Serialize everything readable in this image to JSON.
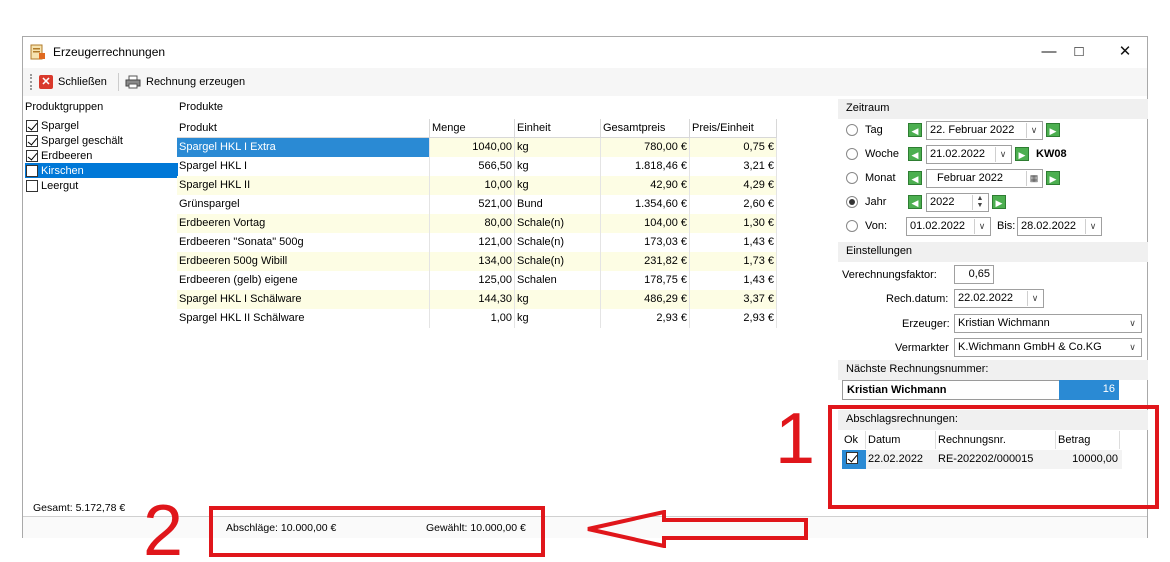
{
  "window": {
    "title": "Erzeugerrechnungen"
  },
  "toolbar": {
    "close_label": "Schließen",
    "invoice_label": "Rechnung erzeugen"
  },
  "groups": {
    "label": "Produktgruppen",
    "items": [
      {
        "label": "Spargel",
        "checked": true
      },
      {
        "label": "Spargel geschält",
        "checked": true
      },
      {
        "label": "Erdbeeren",
        "checked": true
      },
      {
        "label": "Kirschen",
        "checked": false
      },
      {
        "label": "Leergut",
        "checked": false
      }
    ]
  },
  "products": {
    "label": "Produkte",
    "columns": [
      "Produkt",
      "Menge",
      "Einheit",
      "Gesamtpreis",
      "Preis/Einheit"
    ],
    "rows": [
      [
        "Spargel HKL I Extra",
        "1040,00",
        "kg",
        "780,00 €",
        "0,75 €"
      ],
      [
        "Spargel HKL I",
        "566,50",
        "kg",
        "1.818,46 €",
        "3,21 €"
      ],
      [
        "Spargel HKL II",
        "10,00",
        "kg",
        "42,90 €",
        "4,29 €"
      ],
      [
        "Grünspargel",
        "521,00",
        "Bund",
        "1.354,60 €",
        "2,60 €"
      ],
      [
        "Erdbeeren Vortag",
        "80,00",
        "Schale(n)",
        "104,00 €",
        "1,30 €"
      ],
      [
        "Erdbeeren \"Sonata\" 500g",
        "121,00",
        "Schale(n)",
        "173,03 €",
        "1,43 €"
      ],
      [
        "Erdbeeren 500g Wibill",
        "134,00",
        "Schale(n)",
        "231,82 €",
        "1,73 €"
      ],
      [
        "Erdbeeren (gelb) eigene",
        "125,00",
        "Schalen",
        "178,75 €",
        "1,43 €"
      ],
      [
        "Spargel HKL I Schälware",
        "144,30",
        "kg",
        "486,29 €",
        "3,37 €"
      ],
      [
        "Spargel HKL II Schälware",
        "1,00",
        "kg",
        "2,93 €",
        "2,93 €"
      ]
    ]
  },
  "total": "Gesamt: 5.172,78 €",
  "status": {
    "abschlaege": "Abschläge: 10.000,00 €",
    "gewaehlt": "Gewählt: 10.000,00 €"
  },
  "zeitraum": {
    "label": "Zeitraum",
    "tag_label": "Tag",
    "tag_value": "22.  Februar  2022",
    "woche_label": "Woche",
    "woche_value": "21.02.2022",
    "kw": "KW08",
    "monat_label": "Monat",
    "monat_value": "Februar   2022",
    "jahr_label": "Jahr",
    "jahr_value": "2022",
    "von_label": "Von:",
    "von_value": "01.02.2022",
    "bis_label": "Bis:",
    "bis_value": "28.02.2022"
  },
  "einstellungen": {
    "label": "Einstellungen",
    "faktor_label": "Verechnungsfaktor:",
    "faktor_value": "0,65",
    "datum_label": "Rech.datum:",
    "datum_value": "22.02.2022",
    "erzeuger_label": "Erzeuger:",
    "erzeuger_value": "Kristian Wichmann",
    "vermarkter_label": "Vermarkter",
    "vermarkter_value": "K.Wichmann GmbH & Co.KG"
  },
  "naechste": {
    "label": "Nächste Rechnungsnummer:",
    "name": "Kristian Wichmann",
    "number": "16"
  },
  "abschlag": {
    "label": "Abschlagsrechnungen:",
    "columns": [
      "Ok",
      "Datum",
      "Rechnungsnr.",
      "Betrag"
    ],
    "row": {
      "datum": "22.02.2022",
      "nr": "RE-202202/000015",
      "betrag": "10000,00"
    }
  },
  "annotations": {
    "one": "1",
    "two": "2"
  },
  "colors": {
    "selection": "#2a8ad4",
    "annotation": "#e0161b",
    "alt_row": "#fdfde4"
  }
}
